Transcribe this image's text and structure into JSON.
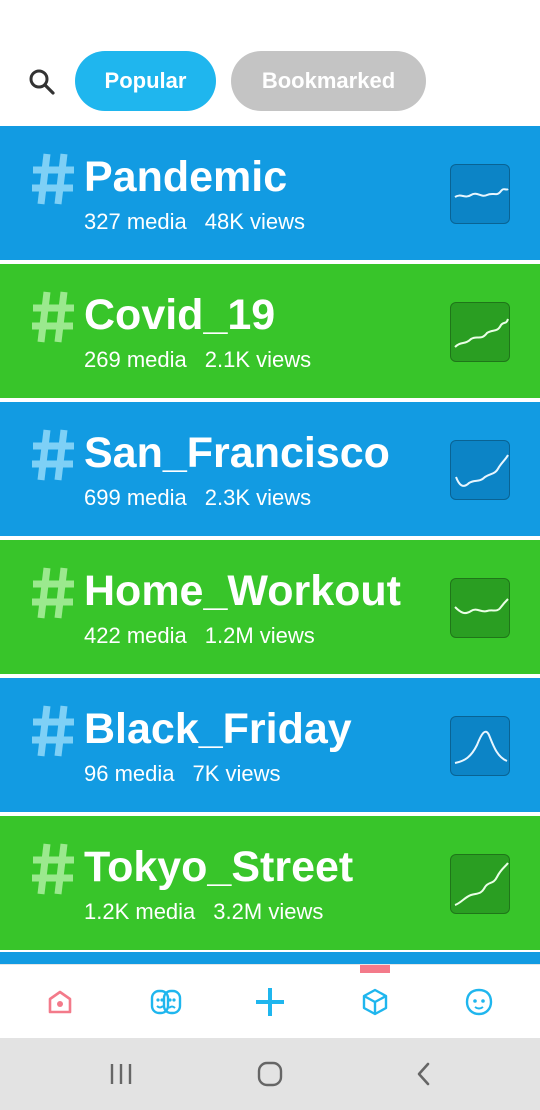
{
  "filters": {
    "search_icon": "search-icon",
    "tabs": [
      {
        "label": "Popular",
        "active": true
      },
      {
        "label": "Bookmarked",
        "active": false
      }
    ]
  },
  "colors": {
    "accent": "#1fb6ee",
    "row_blue": "#129be2",
    "row_green": "#38c52a",
    "nav_active": "#f37a8a",
    "nav_icon": "#1fb6ee"
  },
  "tags": [
    {
      "hash": "#",
      "name": "Pandemic",
      "media": "327 media",
      "views": "48K views",
      "color": "blue",
      "trend": "wavy-flat"
    },
    {
      "hash": "#",
      "name": "Covid_19",
      "media": "269 media",
      "views": "2.1K views",
      "color": "green",
      "trend": "rising"
    },
    {
      "hash": "#",
      "name": "San_Francisco",
      "media": "699 media",
      "views": "2.3K views",
      "color": "blue",
      "trend": "rising-sharp"
    },
    {
      "hash": "#",
      "name": "Home_Workout",
      "media": "422 media",
      "views": "1.2M views",
      "color": "green",
      "trend": "wavy-flat"
    },
    {
      "hash": "#",
      "name": "Black_Friday",
      "media": "96 media",
      "views": "7K views",
      "color": "blue",
      "trend": "peak"
    },
    {
      "hash": "#",
      "name": "Tokyo_Street",
      "media": "1.2K media",
      "views": "3.2M views",
      "color": "green",
      "trend": "rising-sharp"
    }
  ],
  "bottom_nav": [
    {
      "icon": "home-icon",
      "active": true
    },
    {
      "icon": "masks-icon",
      "active": false
    },
    {
      "icon": "plus-icon",
      "active": false
    },
    {
      "icon": "cube-icon",
      "active": false
    },
    {
      "icon": "face-icon",
      "active": false
    }
  ],
  "system_nav": [
    {
      "icon": "recent-apps-icon"
    },
    {
      "icon": "home-circle-icon"
    },
    {
      "icon": "back-icon"
    }
  ]
}
